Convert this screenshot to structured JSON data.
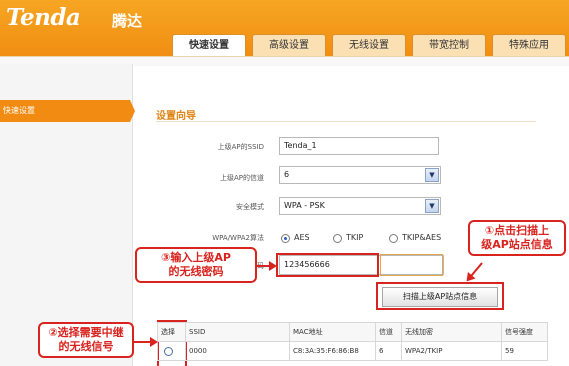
{
  "header": {
    "logo_text": "Tenda",
    "logo_cn": "腾达",
    "tabs": [
      {
        "label": "快速设置",
        "active": true
      },
      {
        "label": "高级设置",
        "active": false
      },
      {
        "label": "无线设置",
        "active": false
      },
      {
        "label": "带宽控制",
        "active": false
      },
      {
        "label": "特殊应用",
        "active": false
      }
    ]
  },
  "sidebar": {
    "items": [
      {
        "label": "快速设置",
        "active": true
      }
    ]
  },
  "main": {
    "section_title": "设置向导",
    "form": {
      "ssid_label": "上级AP的SSID",
      "ssid_value": "Tenda_1",
      "channel_label": "上级AP的信道",
      "channel_value": "6",
      "security_label": "安全模式",
      "security_value": "WPA - PSK",
      "cipher_label": "WPA/WPA2算法",
      "cipher_options": [
        "AES",
        "TKIP",
        "TKIP&AES"
      ],
      "cipher_selected": "AES",
      "password_label": "密码",
      "password_value": "123456666"
    },
    "scan_button_label": "扫描上级AP站点信息",
    "table": {
      "headers": [
        "选择",
        "SSID",
        "MAC地址",
        "信道",
        "无线加密",
        "信号强度"
      ],
      "rows": [
        [
          "",
          "0000",
          "C8:3A:35:F6:86:B8",
          "6",
          "WPA2/TKIP",
          "59"
        ]
      ]
    }
  },
  "annotations": {
    "callout1": [
      "①点击扫描上",
      "级AP站点信息"
    ],
    "callout2": [
      "②选择需要中继",
      "的无线信号"
    ],
    "callout3": [
      "③输入上级AP",
      "的无线密码"
    ]
  },
  "colors": {
    "brand_orange": "#f08a10",
    "annotation_red": "#d9231e",
    "title_orange": "#e08414"
  }
}
